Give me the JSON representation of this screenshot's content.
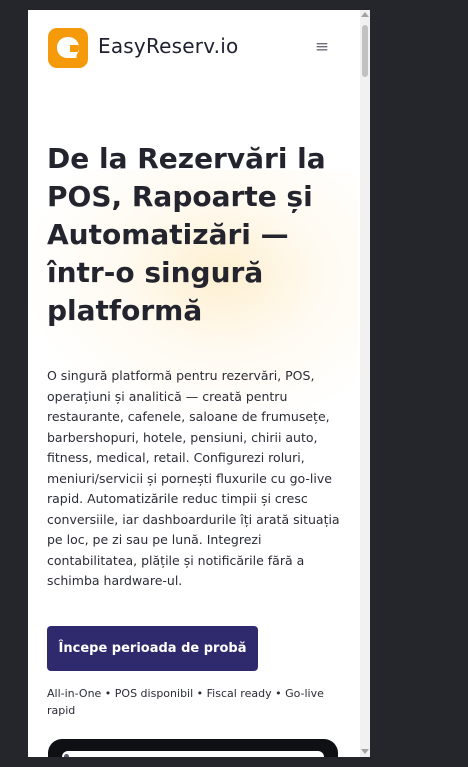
{
  "header": {
    "brand_name": "EasyReserv.io",
    "logo_icon": "speech-bubble-logo",
    "menu_icon": "≡",
    "colors": {
      "logo": "#f59a0b",
      "brand_text": "#1f2030"
    }
  },
  "hero": {
    "title": "De la Rezervări la POS, Rapoarte și Automatizări — într-o singură platformă",
    "description": "O singură platformă pentru rezervări, POS, operațiuni și analitică — creată pentru restaurante, cafenele, saloane de frumusețe, barbershopuri, hotele, pensiuni, chirii auto, fitness, medical, retail. Configurezi roluri, meniuri/servicii și pornești fluxurile cu go-live rapid. Automatizările reduc timpii și cresc conversiile, iar dashboardurile îți arată situația pe loc, pe zi sau pe lună. Integrezi contabilitatea, plățile și notificările fără a schimba hardware-ul.",
    "cta_label": "Începe perioada de probă",
    "features_line": "All-in-One • POS disponibil • Fiscal ready • Go-live rapid",
    "colors": {
      "cta": "#2f2a6e",
      "title": "#23242d"
    }
  }
}
